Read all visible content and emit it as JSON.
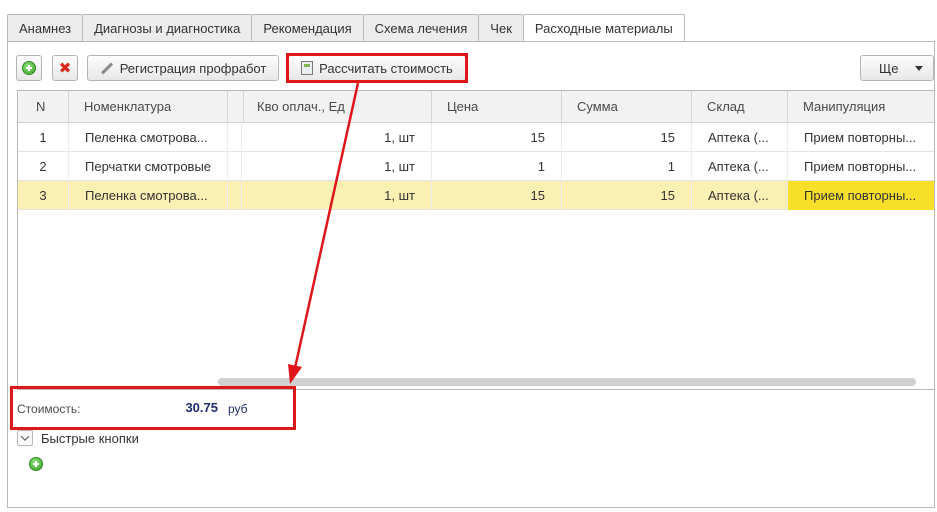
{
  "tabs": [
    {
      "label": "Анамнез"
    },
    {
      "label": "Диагнозы и диагностика"
    },
    {
      "label": "Рекомендация"
    },
    {
      "label": "Схема лечения"
    },
    {
      "label": "Чек"
    },
    {
      "label": "Расходные материалы"
    }
  ],
  "toolbar": {
    "add_icon": "plus-circle-icon",
    "delete_icon": "close-icon",
    "register_label": "Регистрация профработ",
    "calculate_label": "Рассчитать стоимость",
    "more_label": "Ще"
  },
  "table": {
    "columns": [
      "N",
      "Номенклатура",
      "Кво оплач., Ед",
      "Цена",
      "Сумма",
      "Склад",
      "Манипуляция"
    ],
    "rows": [
      {
        "n": "1",
        "nomenclature": "Пеленка смотрова...",
        "qty": "1, шт",
        "price": "15",
        "sum": "15",
        "warehouse": "Аптека (...",
        "manipulation": "Прием повторны..."
      },
      {
        "n": "2",
        "nomenclature": "Перчатки смотровые",
        "qty": "1, шт",
        "price": "1",
        "sum": "1",
        "warehouse": "Аптека (...",
        "manipulation": "Прием повторны..."
      },
      {
        "n": "3",
        "nomenclature": "Пеленка смотрова...",
        "qty": "1, шт",
        "price": "15",
        "sum": "15",
        "warehouse": "Аптека (...",
        "manipulation": "Прием повторны..."
      }
    ],
    "selected_row": 3
  },
  "cost": {
    "label": "Стоимость:",
    "value": "30.75",
    "unit": "руб"
  },
  "quick_buttons": {
    "label": "Быстрые кнопки"
  },
  "colors": {
    "annotation": "#e0161b",
    "selected_row": "#fbf0b4",
    "selected_cell": "#f8df2a",
    "cost_value": "#1f2d6e"
  }
}
